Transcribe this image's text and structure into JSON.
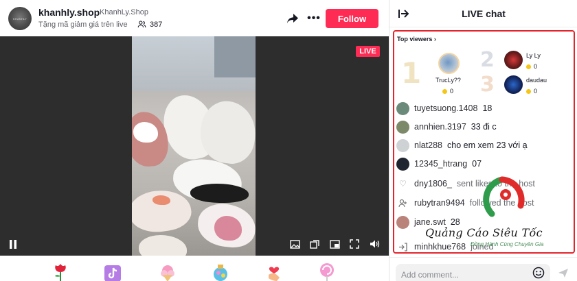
{
  "host": {
    "name": "khanhly.shop",
    "handle": "KhanhLy.Shop",
    "subtitle": "Tặng mã giảm giá trên live",
    "viewer_count": "387",
    "follow_label": "Follow",
    "more_label": "•••"
  },
  "stream": {
    "live_badge": "LIVE"
  },
  "chat": {
    "title": "LIVE chat",
    "top_viewers_title": "Top viewers",
    "top_viewers": [
      {
        "rank": "1",
        "name": "TrucLy??",
        "score": "0"
      },
      {
        "rank": "2",
        "name": "Ly Ly",
        "score": "0"
      },
      {
        "rank": "3",
        "name": "daudau",
        "score": "0"
      }
    ],
    "messages": [
      {
        "user": "tuyetsuong.1408",
        "text": "18"
      },
      {
        "user": "annhien.3197",
        "text": "33 đi c"
      },
      {
        "user": "nlat288",
        "text": "cho em xem 23 với ạ"
      },
      {
        "user": "12345_htrang",
        "text": "07"
      },
      {
        "user": "dny1806_",
        "text": "sent likes to the host"
      },
      {
        "user": "rubytran9494",
        "text": "followed the host"
      },
      {
        "user": "jane.swt",
        "text": "28"
      },
      {
        "user": "minhkhue768",
        "text": "joined"
      }
    ],
    "comment_placeholder": "Add comment..."
  },
  "watermark": {
    "title": "Quảng Cáo Siêu Tốc",
    "subtitle": "Đồng Hành Cùng Chuyên Gia"
  },
  "colors": {
    "accent": "#fe2c55",
    "highlight_border": "#e2252c",
    "watermark_red": "#e02b2b",
    "watermark_green": "#2e9c4a"
  }
}
